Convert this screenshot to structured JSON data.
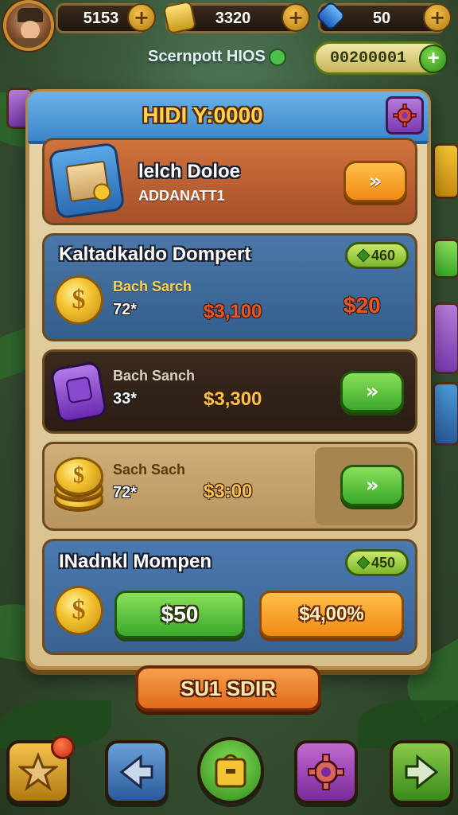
{
  "top_bar": {
    "currency_1": "5153",
    "currency_2": "3320",
    "currency_3": "50",
    "subtitle": "Scernpott HIOS",
    "score": "00200001",
    "plus": "+"
  },
  "modal": {
    "title": "HIDI Y:0000",
    "featured": {
      "title": "lelch Doloe",
      "subtitle": "ADDANATT1",
      "button_icon": "double-chevron-right-icon"
    },
    "section_a": {
      "title": "Kaltadkaldo Dompert",
      "badge": "460",
      "item_label": "Bach Sarch",
      "item_qty": "72*",
      "item_price": "$3,100",
      "price_right": "$20"
    },
    "row_b": {
      "item_label": "Bach Sanch",
      "item_qty": "33*",
      "item_price": "$3,300"
    },
    "row_c": {
      "item_label": "Sach Sach",
      "item_qty": "72*",
      "item_price": "$3:00"
    },
    "section_d": {
      "title": "INadnkl Mompen",
      "badge": "450",
      "buy_green": "$50",
      "buy_orange": "$4,00%"
    }
  },
  "bottom_button": "SU1 SDIR",
  "nav": [
    {
      "icon": "star-icon"
    },
    {
      "icon": "arrow-left-icon"
    },
    {
      "icon": "shop-bag-icon"
    },
    {
      "icon": "gear-icon"
    },
    {
      "icon": "arrow-right-icon"
    }
  ],
  "colors": {
    "accent_gold": "#ffd44a",
    "header_blue": "#3a86c8",
    "green_button": "#3aa82a",
    "orange_button": "#f08a14",
    "price_red": "#e8552a"
  }
}
